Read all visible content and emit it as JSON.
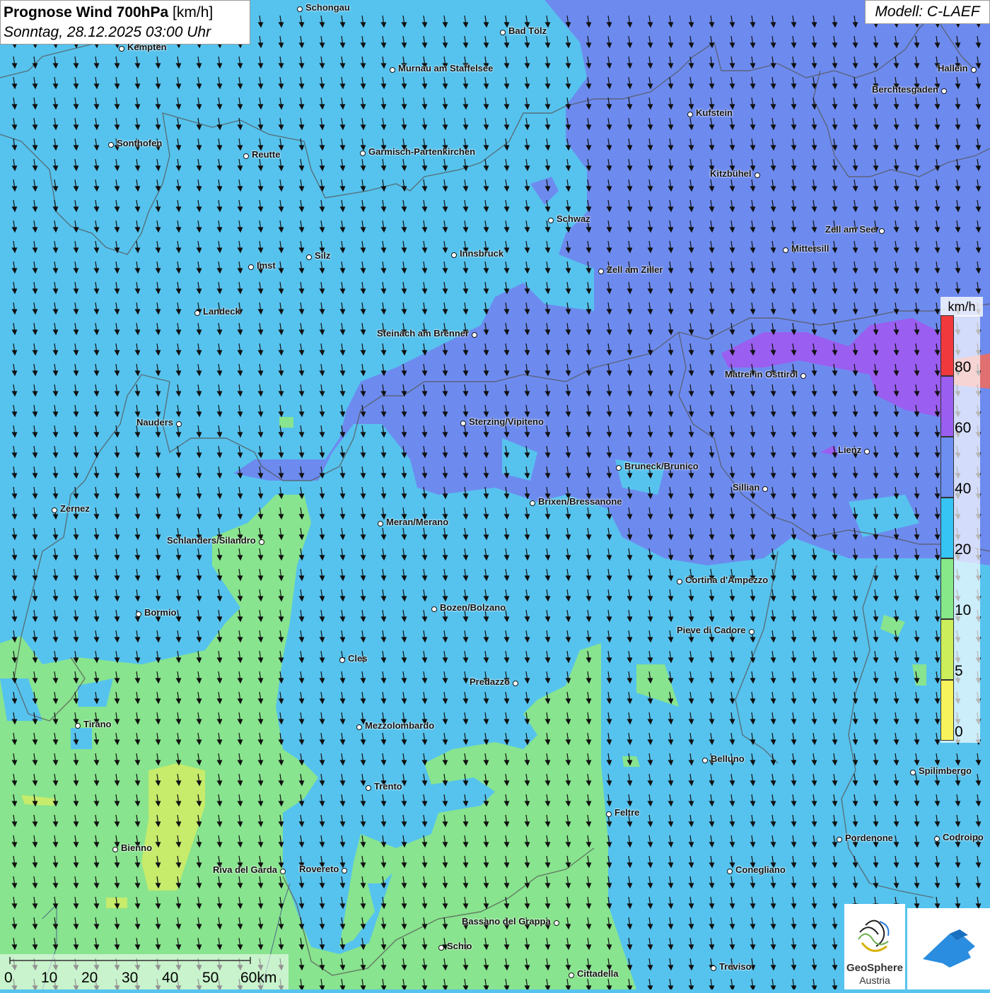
{
  "title": {
    "main": "Prognose Wind 700hPa",
    "unit": "[km/h]",
    "datetime": "Sonntag, 28.12.2025 03:00 Uhr"
  },
  "model": "Modell: C-LAEF",
  "legend": {
    "unit": "km/h",
    "labels": [
      "80",
      "60",
      "40",
      "20",
      "10",
      "5",
      "0"
    ],
    "colors": [
      "#f0393c",
      "#9a5ef0",
      "#6d8ff2",
      "#35c4f3",
      "#86e889",
      "#cbee5a",
      "#f7f35c"
    ]
  },
  "scale": {
    "labels": [
      "0",
      "10",
      "20",
      "30",
      "40",
      "50",
      "60km"
    ]
  },
  "logos": {
    "geosphere_line1": "GeoSphere",
    "geosphere_line2": "Austria",
    "geosphere_icon": "geosphere-logo-icon",
    "second_icon": "cloud-arrow-logo-icon"
  },
  "cities": [
    "Schongau",
    "Bad Tölz",
    "Kempten",
    "Murnau am Staffelsee",
    "Hallein",
    "Berchtesgaden",
    "Kufstein",
    "Sonthofen",
    "Reutte",
    "Garmisch-Partenkirchen",
    "Kitzbühel",
    "Schwaz",
    "Zell am See",
    "Mittersill",
    "Innsbruck",
    "Silz",
    "Imst",
    "Zell am Ziller",
    "Landeck",
    "Steinach am Brenner",
    "Matrei in Osttirol",
    "Nauders",
    "Sterzing/Vipiteno",
    "Lienz",
    "Bruneck/Brunico",
    "Sillian",
    "Zernez",
    "Brixen/Bressanone",
    "Meran/Merano",
    "Schlanders/Silandro",
    "Cortina d'Ampezzo",
    "Bozen/Bolzano",
    "Bormio",
    "Pieve di Cadore",
    "Cles",
    "Predazzo",
    "Tirano",
    "Mezzolombardo",
    "Belluno",
    "Spilimbergo",
    "Trento",
    "Feltre",
    "Bienno",
    "Pordenone",
    "Codroipo",
    "Riva del Garda",
    "Rovereto",
    "Conegliano",
    "Bassano del Grappa",
    "Schio",
    "Treviso",
    "Cittadella"
  ],
  "wind": {
    "direction": "from north (arrows pointing south)"
  }
}
